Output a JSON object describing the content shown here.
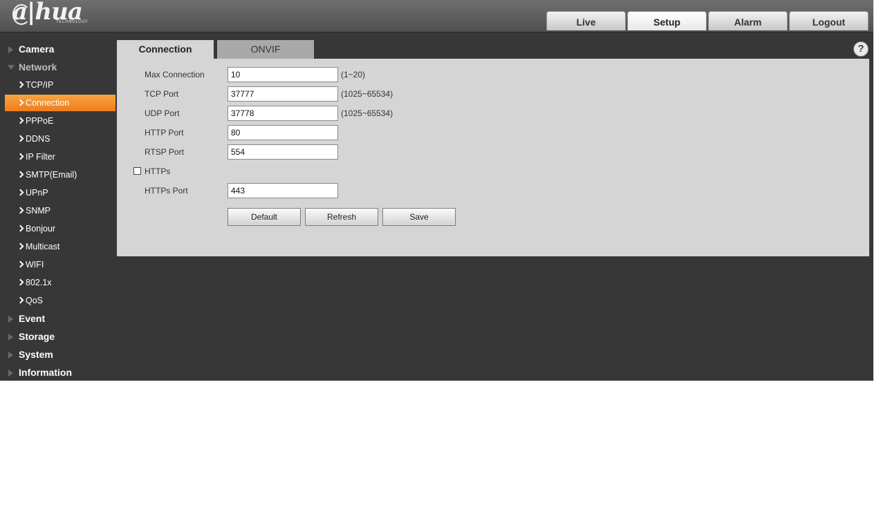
{
  "brand": {
    "logo_text": "a|hua",
    "logo_sub": "TECHNOLOGY"
  },
  "nav_tabs": [
    {
      "label": "Live"
    },
    {
      "label": "Setup"
    },
    {
      "label": "Alarm"
    },
    {
      "label": "Logout"
    }
  ],
  "sidebar": {
    "camera": "Camera",
    "network": "Network",
    "network_items": [
      {
        "label": "TCP/IP"
      },
      {
        "label": "Connection"
      },
      {
        "label": "PPPoE"
      },
      {
        "label": "DDNS"
      },
      {
        "label": "IP Filter"
      },
      {
        "label": "SMTP(Email)"
      },
      {
        "label": "UPnP"
      },
      {
        "label": "SNMP"
      },
      {
        "label": "Bonjour"
      },
      {
        "label": "Multicast"
      },
      {
        "label": "WIFI"
      },
      {
        "label": "802.1x"
      },
      {
        "label": "QoS"
      }
    ],
    "event": "Event",
    "storage": "Storage",
    "system": "System",
    "information": "Information"
  },
  "content_tabs": [
    {
      "label": "Connection"
    },
    {
      "label": "ONVIF"
    }
  ],
  "help": "?",
  "form": {
    "max_connection": {
      "label": "Max Connection",
      "value": "10",
      "hint": "(1~20)"
    },
    "tcp_port": {
      "label": "TCP Port",
      "value": "37777",
      "hint": "(1025~65534)"
    },
    "udp_port": {
      "label": "UDP Port",
      "value": "37778",
      "hint": "(1025~65534)"
    },
    "http_port": {
      "label": "HTTP Port",
      "value": "80"
    },
    "rtsp_port": {
      "label": "RTSP Port",
      "value": "554"
    },
    "https": {
      "label": "HTTPs",
      "checked": false
    },
    "https_port": {
      "label": "HTTPs Port",
      "value": "443"
    }
  },
  "buttons": {
    "default": "Default",
    "refresh": "Refresh",
    "save": "Save"
  },
  "colors": {
    "accent": "#f28a2a",
    "topbar": "#5f5f5f",
    "background": "#373737",
    "panel": "#d5d5d5"
  }
}
